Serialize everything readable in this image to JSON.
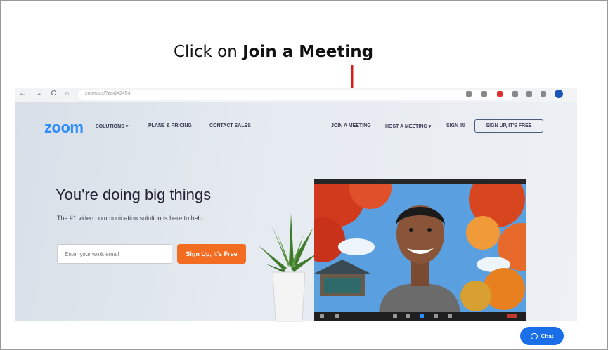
{
  "instruction": {
    "prefix": "Click on ",
    "target": "Join a Meeting"
  },
  "browser": {
    "nav_buttons": "← → C ⌂",
    "url": "zoom.us/?zcid=2454"
  },
  "site": {
    "logo": "zoom",
    "nav_left": [
      "SOLUTIONS ▾",
      "PLANS & PRICING",
      "CONTACT SALES"
    ],
    "nav_right": [
      "JOIN A MEETING",
      "HOST A MEETING ▾",
      "SIGN IN"
    ],
    "signup_free": "SIGN UP, IT'S FREE"
  },
  "hero": {
    "headline": "You're doing big things",
    "subhead": "The #1 video communication solution is here to help",
    "email_placeholder": "Enter your work email",
    "signup_button": "Sign Up, It's Free"
  },
  "chat": {
    "label": "Chat"
  },
  "colors": {
    "zoom_blue": "#2d8cff",
    "signup_orange": "#f26d21",
    "arrow_red": "#d91c1c",
    "chat_blue": "#1a6fe8"
  }
}
